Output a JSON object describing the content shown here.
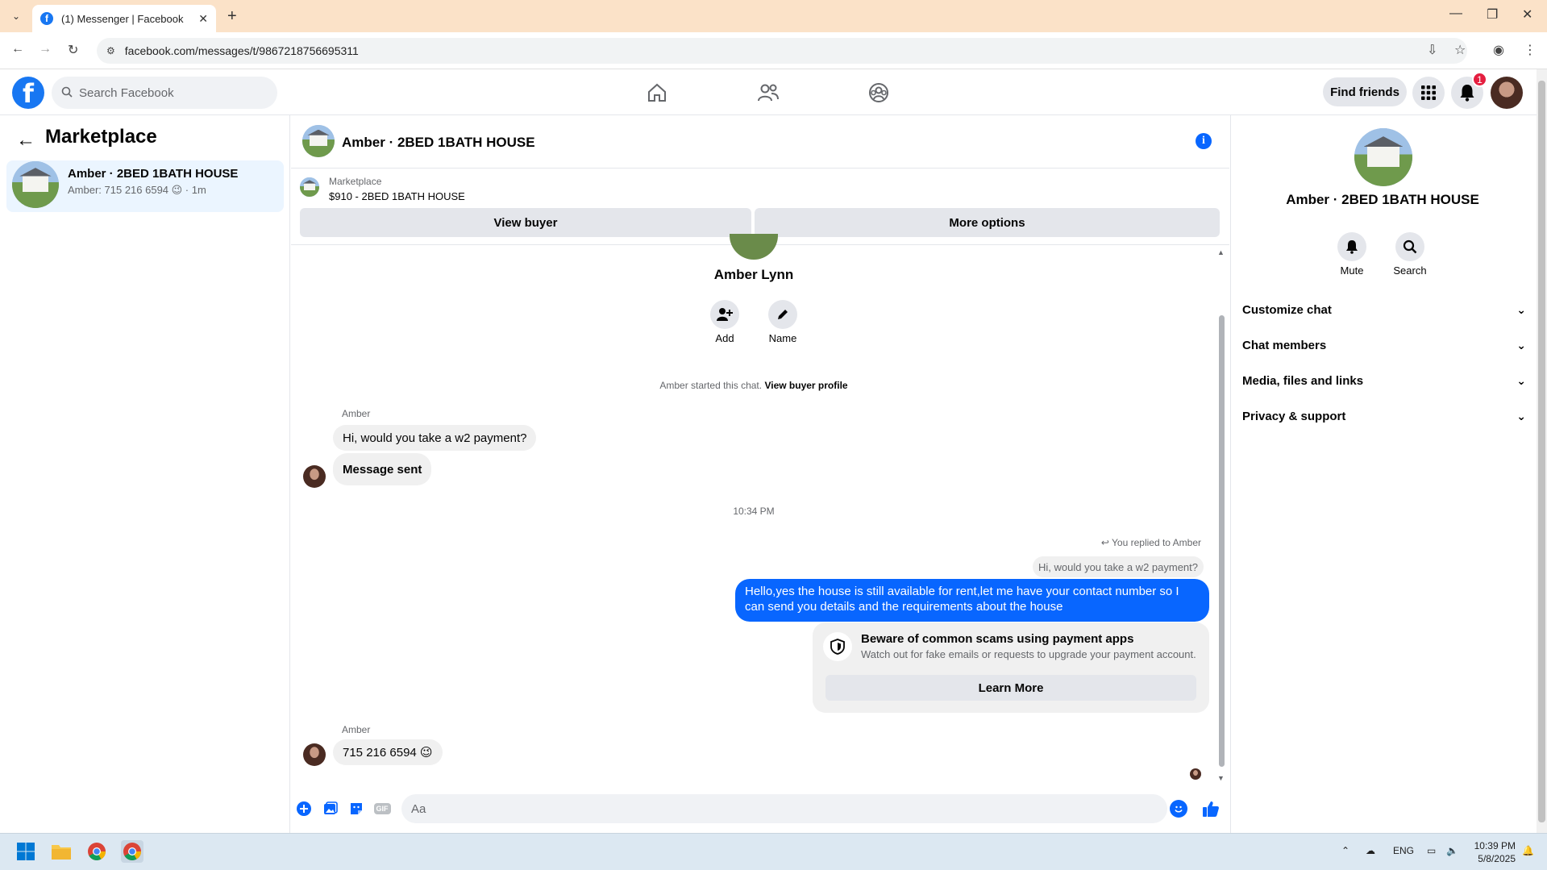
{
  "browser": {
    "tab_title": "(1) Messenger | Facebook",
    "url": "facebook.com/messages/t/9867218756695311",
    "icons": [
      "tab-list-icon",
      "close-tab-icon",
      "new-tab-icon",
      "minimize-icon",
      "maximize-icon",
      "close-window-icon",
      "back-icon",
      "forward-icon",
      "reload-icon",
      "site-info-icon",
      "install-icon",
      "bookmark-star-icon",
      "profile-icon",
      "menu-kebab-icon"
    ]
  },
  "fb_nav": {
    "search_placeholder": "Search Facebook",
    "find_friends": "Find friends",
    "notification_count": "1",
    "accent": "#1877f2"
  },
  "left_panel": {
    "title": "Marketplace",
    "conversation": {
      "title": "Amber · 2BED 1BATH HOUSE",
      "preview": "Amber: 715 216 6594 😉 · 1m"
    }
  },
  "chat": {
    "header_title": "Amber · 2BED 1BATH HOUSE",
    "marketplace_label": "Marketplace",
    "listing": "$910 - 2BED 1BATH HOUSE",
    "view_buyer": "View buyer",
    "more_options": "More options",
    "profile_name": "Amber Lynn",
    "add_label": "Add",
    "name_label": "Name",
    "started_text": "Amber started this chat.",
    "started_link": "View buyer profile",
    "sender1": "Amber",
    "msg1": "Hi, would you take a w2 payment?",
    "msg2": "Message sent",
    "timestamp": "10:34 PM",
    "replied_to": "You replied to Amber",
    "quoted": "Hi, would you take a w2 payment?",
    "my_reply": "Hello,yes the house is still available for rent,let me have your contact number   so I can send you details and the requirements about the house",
    "warning_title": "Beware of common scams using payment apps",
    "warning_sub": "Watch out for fake emails or requests to upgrade your payment account.",
    "learn_more": "Learn More",
    "sender2": "Amber",
    "msg3": "715 216 6594 😉",
    "composer_placeholder": "Aa",
    "gif_label": "GIF",
    "outgoing_color": "#0866ff"
  },
  "right_panel": {
    "title": "Amber · 2BED 1BATH HOUSE",
    "mute": "Mute",
    "search": "Search",
    "sections": [
      "Customize chat",
      "Chat members",
      "Media, files and links",
      "Privacy & support"
    ]
  },
  "taskbar": {
    "lang": "ENG",
    "time": "10:39 PM",
    "date": "5/8/2025"
  }
}
